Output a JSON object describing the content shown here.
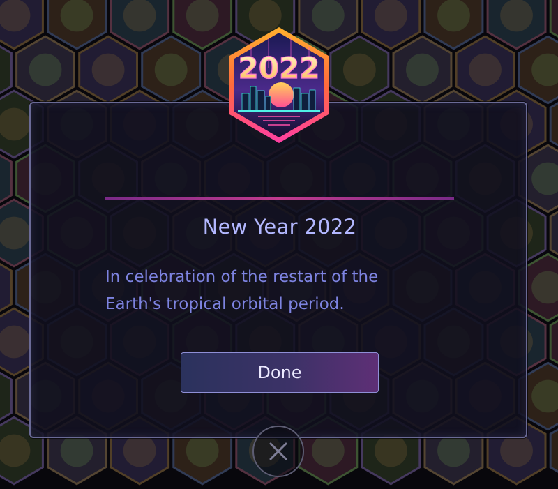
{
  "background": {
    "badge_grid": "hexagon-badge-grid"
  },
  "badge": {
    "year_text": "2022",
    "icon": "new-year-2022-badge-icon"
  },
  "dialog": {
    "title": "New Year 2022",
    "description_line1": "In celebration of the restart of the",
    "description_line2": "Earth's tropical orbital period.",
    "done_label": "Done"
  },
  "close": {
    "icon": "close-icon"
  },
  "colors": {
    "title": "#b2b7ff",
    "description": "#7d83e0",
    "divider": "#c23b8e",
    "border": "#6a6a96",
    "button_start": "#2b325d",
    "button_end": "#5e2f76"
  }
}
